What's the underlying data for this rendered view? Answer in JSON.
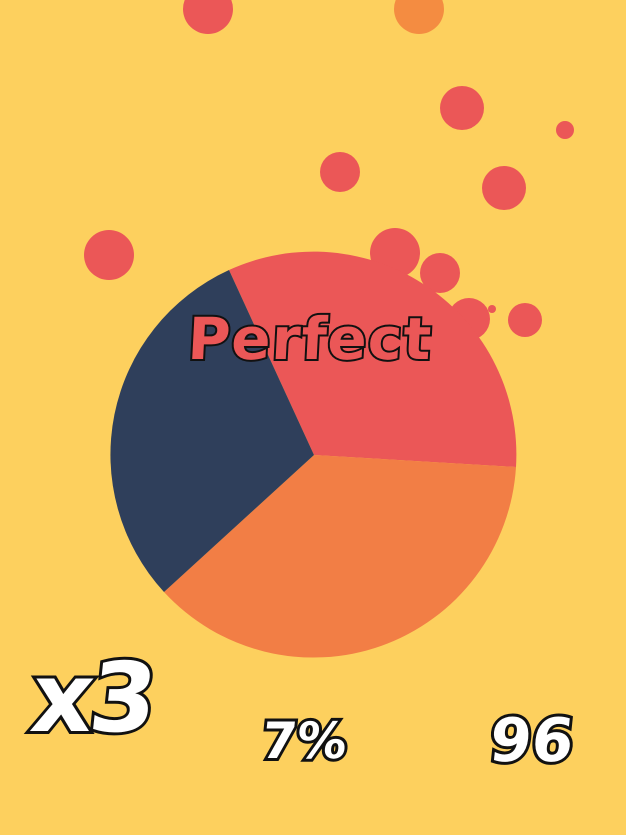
{
  "feedback": {
    "text": "Perfect"
  },
  "hud": {
    "multiplier": "x3",
    "progress": "7%",
    "score": "96"
  },
  "colors": {
    "background": "#FDD05E",
    "red": "#EB5757",
    "orange": "#F27E45",
    "navy": "#2F3F5B",
    "bubble_orange": "#F48C41"
  },
  "wheel": {
    "segments": [
      {
        "name": "red-segment",
        "color": "#EB5757"
      },
      {
        "name": "orange-segment",
        "color": "#F27E45"
      },
      {
        "name": "navy-segment",
        "color": "#2F3F5B"
      }
    ]
  }
}
